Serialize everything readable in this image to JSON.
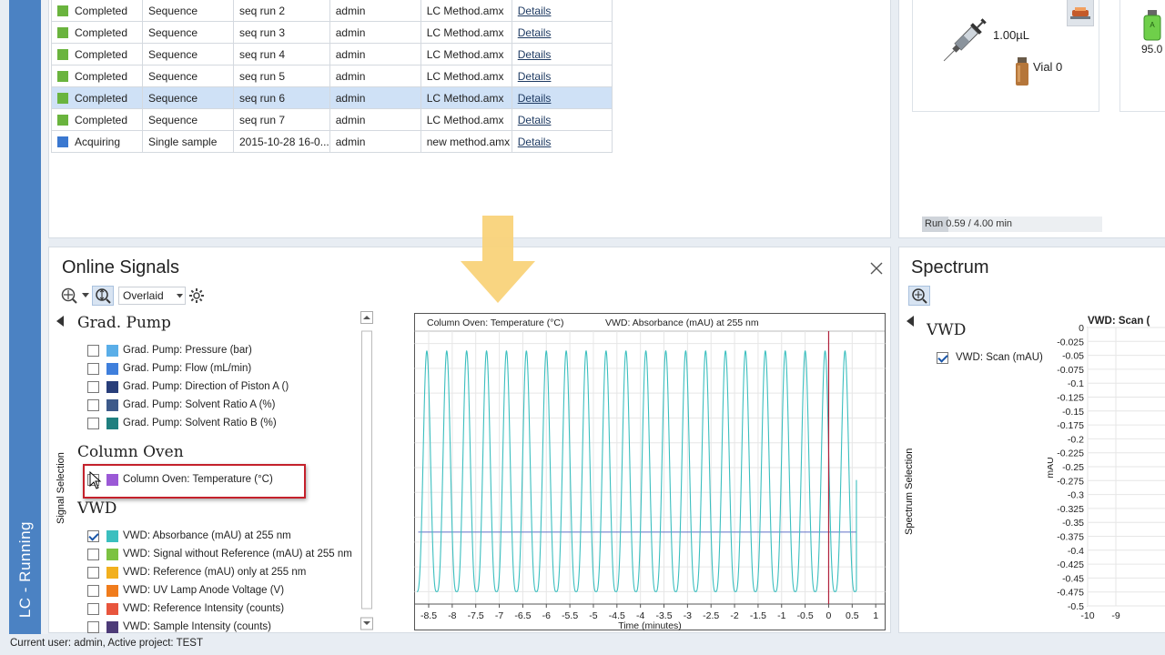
{
  "app": {
    "mode_label": "LC - Running"
  },
  "queue": {
    "rows": [
      {
        "status": "Completed",
        "status_color": "#6ab43e",
        "type": "Sequence",
        "name": "seq run 2",
        "user": "admin",
        "method": "LC Method.amx",
        "link": "Details",
        "selected": false
      },
      {
        "status": "Completed",
        "status_color": "#6ab43e",
        "type": "Sequence",
        "name": "seq run 3",
        "user": "admin",
        "method": "LC Method.amx",
        "link": "Details",
        "selected": false
      },
      {
        "status": "Completed",
        "status_color": "#6ab43e",
        "type": "Sequence",
        "name": "seq run 4",
        "user": "admin",
        "method": "LC Method.amx",
        "link": "Details",
        "selected": false
      },
      {
        "status": "Completed",
        "status_color": "#6ab43e",
        "type": "Sequence",
        "name": "seq run 5",
        "user": "admin",
        "method": "LC Method.amx",
        "link": "Details",
        "selected": false
      },
      {
        "status": "Completed",
        "status_color": "#6ab43e",
        "type": "Sequence",
        "name": "seq run 6",
        "user": "admin",
        "method": "LC Method.amx",
        "link": "Details",
        "selected": true
      },
      {
        "status": "Completed",
        "status_color": "#6ab43e",
        "type": "Sequence",
        "name": "seq run 7",
        "user": "admin",
        "method": "LC Method.amx",
        "link": "Details",
        "selected": false
      },
      {
        "status": "Acquiring",
        "status_color": "#3a78d0",
        "type": "Single sample",
        "name": "2015-10-28 16-0...",
        "user": "admin",
        "method": "new method.amx",
        "link": "Details",
        "selected": false
      }
    ]
  },
  "injector": {
    "volume": "1.00µL",
    "vial": "Vial 0",
    "bottle_value": "95.0",
    "bottle_letter": "A",
    "run_progress": "Run 0.59 / 4.00 min",
    "run_fraction": 0.1475
  },
  "signals": {
    "title": "Online Signals",
    "view_mode": "Overlaid",
    "side_label": "Signal Selection",
    "groups": {
      "pump": {
        "title": "Grad. Pump",
        "items": [
          {
            "label": "Grad. Pump: Pressure (bar)",
            "color": "#5aaee8",
            "checked": false
          },
          {
            "label": "Grad. Pump: Flow (mL/min)",
            "color": "#3f7fdc",
            "checked": false
          },
          {
            "label": "Grad. Pump: Direction of Piston A ()",
            "color": "#283e7a",
            "checked": false
          },
          {
            "label": "Grad. Pump: Solvent Ratio A (%)",
            "color": "#3d5a8a",
            "checked": false
          },
          {
            "label": "Grad. Pump: Solvent Ratio B (%)",
            "color": "#1f7f7f",
            "checked": false
          }
        ]
      },
      "oven": {
        "title": "Column Oven",
        "items": [
          {
            "label": "Column Oven: Temperature (°C)",
            "color": "#9b59d6",
            "checked": false
          }
        ]
      },
      "vwd": {
        "title": "VWD",
        "items": [
          {
            "label": "VWD: Absorbance (mAU) at 255 nm",
            "color": "#3bbfbf",
            "checked": true
          },
          {
            "label": "VWD: Signal without Reference (mAU) at 255 nm",
            "color": "#7cc242",
            "checked": false
          },
          {
            "label": "VWD: Reference (mAU) only at 255 nm",
            "color": "#f2b01e",
            "checked": false
          },
          {
            "label": "VWD: UV Lamp Anode Voltage (V)",
            "color": "#f07c1c",
            "checked": false
          },
          {
            "label": "VWD: Reference Intensity (counts)",
            "color": "#e8553d",
            "checked": false
          },
          {
            "label": "VWD: Sample Intensity (counts)",
            "color": "#4d3b78",
            "checked": false
          }
        ]
      }
    }
  },
  "chart_data": [
    {
      "type": "line",
      "legend": [
        {
          "name": "Column Oven: Temperature (°C)",
          "color": "#a05cc8"
        },
        {
          "name": "VWD: Absorbance (mAU) at 255 nm",
          "color": "#3bbfbf"
        }
      ],
      "series": [
        {
          "name": "Column Oven: Temperature (°C)",
          "color": "#6070c8",
          "constant": 24
        },
        {
          "name": "VWD: Absorbance (mAU) at 255 nm",
          "color": "#3bbfbf",
          "shape": "periodic peaks",
          "min": 0,
          "max": 97,
          "period_min": 0.4232,
          "first_peak_x": -8.54,
          "last_x": 0.59,
          "last_y": 45
        }
      ],
      "xlabel": "Time (minutes)",
      "ylabel": "",
      "xlim": [
        -8.8,
        1.2
      ],
      "ylim": [
        -5,
        105
      ],
      "x_ticks": [
        -8.5,
        -8,
        -7.5,
        -7,
        -6.5,
        -6,
        -5.5,
        -5,
        -4.5,
        -4,
        -3.5,
        -3,
        -2.5,
        -2,
        -1.5,
        -1,
        -0.5,
        0,
        0.5,
        1
      ],
      "y_ticks": [
        0,
        10,
        20,
        30,
        40,
        50,
        60,
        70,
        80,
        90,
        100
      ],
      "current_time": 0,
      "grid": true
    },
    {
      "type": "line",
      "title": "VWD: Scan (",
      "ylabel": "mAU",
      "y_ticks": [
        0,
        -0.025,
        -0.05,
        -0.075,
        -0.1,
        -0.125,
        -0.15,
        -0.175,
        -0.2,
        -0.225,
        -0.25,
        -0.275,
        -0.3,
        -0.325,
        -0.35,
        -0.375,
        -0.4,
        -0.425,
        -0.45,
        -0.475,
        -0.5
      ],
      "x_ticks": [
        -10,
        -9
      ],
      "series": [],
      "grid": true
    }
  ],
  "spectrum": {
    "title": "Spectrum",
    "group_title": "VWD",
    "item_label": "VWD: Scan (mAU)",
    "item_checked": true,
    "side_label": "Spectrum Selection"
  },
  "status_bar": {
    "text": "Current user: admin, Active project: TEST"
  },
  "colors": {
    "highlight": "#c4212b",
    "arrow": "#f9d37a",
    "accent": "#4b82c3",
    "current_time_line": "#b0203a"
  }
}
